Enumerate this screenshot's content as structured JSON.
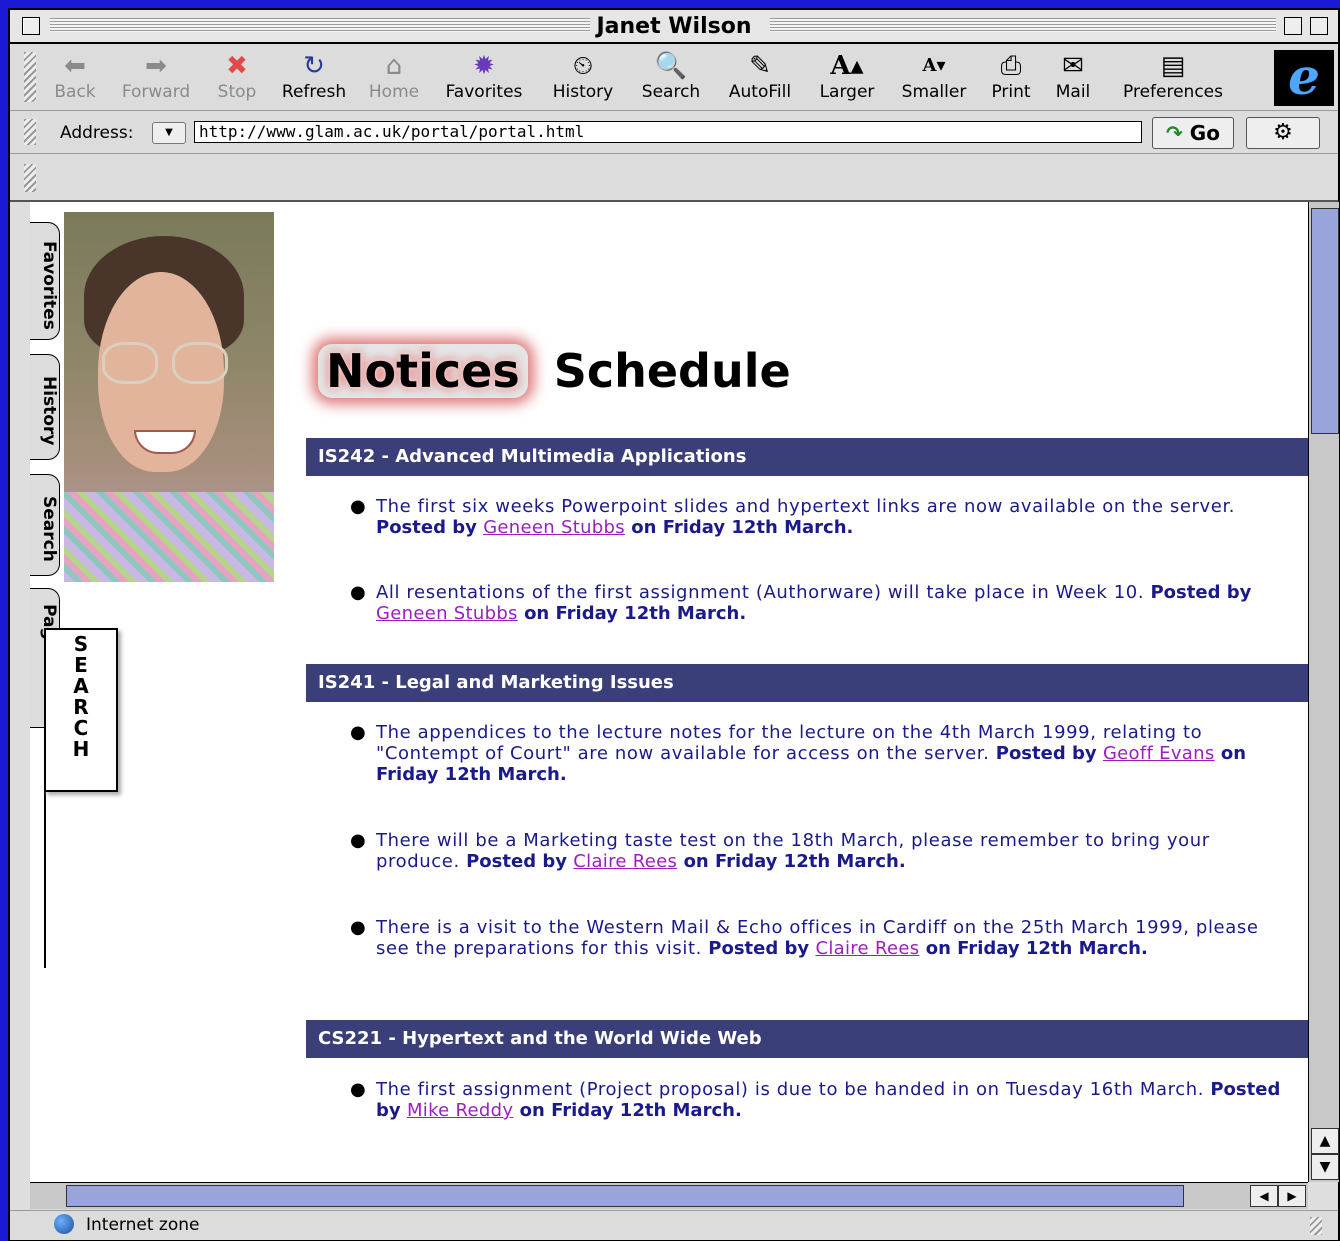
{
  "window": {
    "title": "Janet Wilson"
  },
  "toolbar": {
    "buttons": [
      {
        "label": "Back",
        "icon": "back-arrow-icon",
        "disabled": true
      },
      {
        "label": "Forward",
        "icon": "forward-arrow-icon",
        "disabled": true
      },
      {
        "label": "Stop",
        "icon": "stop-icon",
        "disabled": true
      },
      {
        "label": "Refresh",
        "icon": "refresh-icon"
      },
      {
        "label": "Home",
        "icon": "home-icon",
        "disabled": true
      },
      {
        "label": "Favorites",
        "icon": "favorites-icon"
      },
      {
        "label": "History",
        "icon": "history-icon"
      },
      {
        "label": "Search",
        "icon": "search-icon"
      },
      {
        "label": "AutoFill",
        "icon": "autofill-icon"
      },
      {
        "label": "Larger",
        "icon": "larger-text-icon"
      },
      {
        "label": "Smaller",
        "icon": "smaller-text-icon"
      },
      {
        "label": "Print",
        "icon": "print-icon"
      },
      {
        "label": "Mail",
        "icon": "mail-icon"
      },
      {
        "label": "Preferences",
        "icon": "preferences-icon"
      }
    ]
  },
  "address": {
    "label": "Address:",
    "url": "http://www.glam.ac.uk/portal/portal.html",
    "go_label": "Go"
  },
  "sidebar": {
    "tabs": [
      "Favorites",
      "History",
      "Search",
      "Page Holder"
    ],
    "search_panel_label": "SEARCH"
  },
  "page": {
    "heading_notices": "Notices",
    "heading_schedule": "Schedule",
    "sections": [
      {
        "title": "IS242 - Advanced Multimedia Applications",
        "notices": [
          {
            "text": "The first six weeks Powerpoint slides and hypertext links are now available on the server.",
            "posted_by_label": "Posted by",
            "author": "Geneen Stubbs",
            "date": "on Friday 12th March."
          },
          {
            "text": "All resentations of the first assignment (Authorware) will take place in Week 10.",
            "posted_by_label": "Posted by",
            "author": "Geneen Stubbs",
            "date": "on Friday 12th March."
          }
        ]
      },
      {
        "title": "IS241 - Legal and Marketing Issues",
        "notices": [
          {
            "text": "The appendices to the lecture notes for the lecture on the 4th March 1999, relating to \"Contempt of Court\" are now available for access on the server.",
            "posted_by_label": "Posted by",
            "author": "Geoff Evans",
            "date": "on Friday 12th March."
          },
          {
            "text": "There will be a Marketing taste test on the 18th March, please remember to bring your produce.",
            "posted_by_label": "Posted by",
            "author": "Claire Rees",
            "date": "on Friday 12th March."
          },
          {
            "text": "There is a visit to the Western Mail & Echo offices in Cardiff on the 25th March 1999, please see the preparations for this visit.",
            "posted_by_label": "Posted by",
            "author": "Claire Rees",
            "date": "on Friday 12th March."
          }
        ]
      },
      {
        "title": "CS221 - Hypertext and the World Wide Web",
        "notices": [
          {
            "text": "The first assignment (Project proposal) is due to be handed in on Tuesday 16th March.",
            "posted_by_label": "Posted by",
            "author": "Mike Reddy",
            "date": "on Friday 12th March."
          }
        ]
      }
    ]
  },
  "status": {
    "zone": "Internet zone"
  },
  "colors": {
    "desktop": "#1a1ad6",
    "section_bar": "#3a3f7a",
    "notice_text": "#1a1a8a",
    "link": "#9b1fbf",
    "scroll_thumb": "#9aa4dc"
  }
}
